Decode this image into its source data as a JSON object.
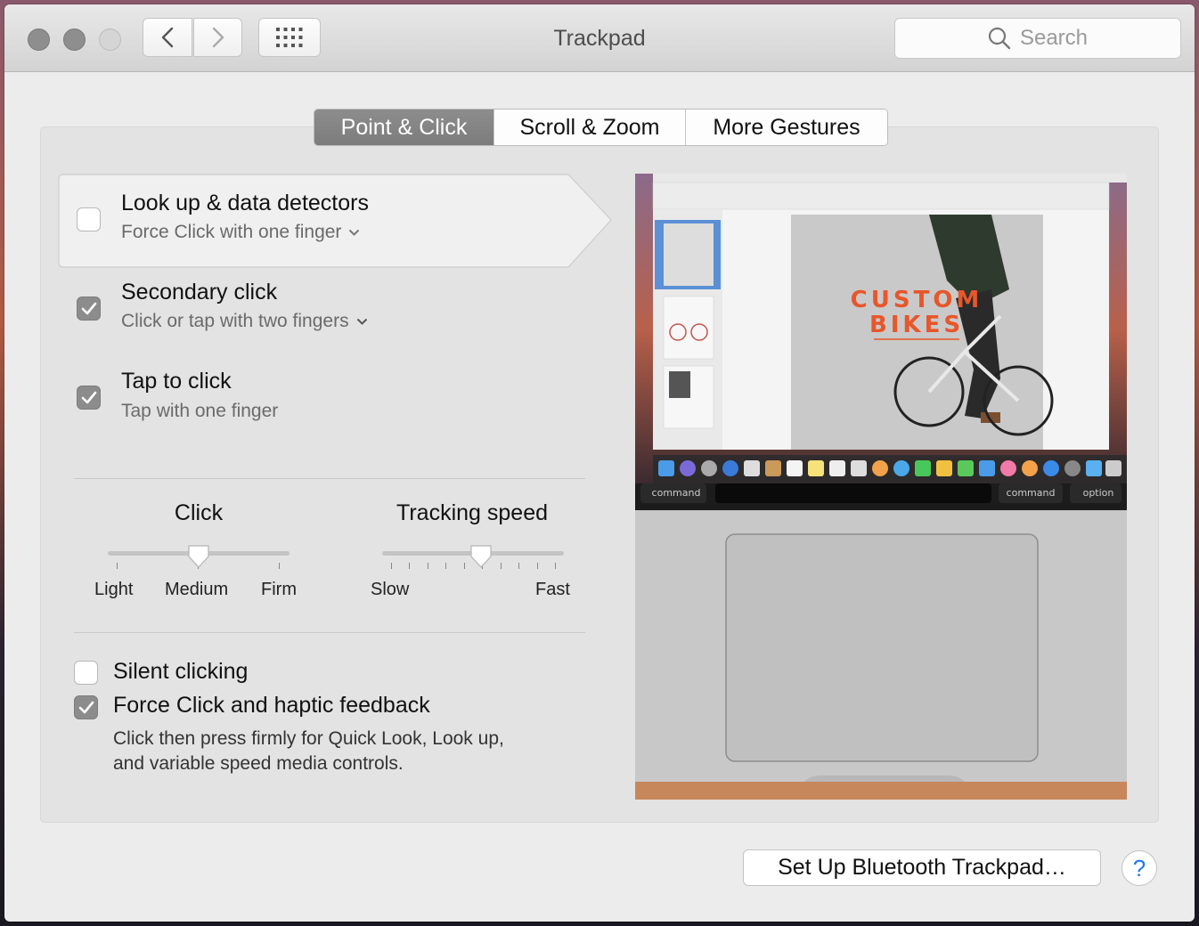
{
  "window": {
    "title": "Trackpad"
  },
  "toolbar": {
    "search_placeholder": "Search"
  },
  "tabs": [
    {
      "label": "Point & Click",
      "active": true
    },
    {
      "label": "Scroll & Zoom",
      "active": false
    },
    {
      "label": "More Gestures",
      "active": false
    }
  ],
  "options": {
    "lookup": {
      "title": "Look up & data detectors",
      "sub": "Force Click with one finger",
      "checked": false
    },
    "secondary": {
      "title": "Secondary click",
      "sub": "Click or tap with two fingers",
      "checked": true
    },
    "tap": {
      "title": "Tap to click",
      "sub": "Tap with one finger",
      "checked": true
    }
  },
  "sliders": {
    "click": {
      "label": "Click",
      "ticks": [
        "Light",
        "Medium",
        "Firm"
      ],
      "value": "Medium"
    },
    "tracking": {
      "label": "Tracking speed",
      "min_label": "Slow",
      "max_label": "Fast",
      "value_fraction": 0.55
    }
  },
  "bottom_options": {
    "silent": {
      "title": "Silent clicking",
      "checked": false
    },
    "force": {
      "title": "Force Click and haptic feedback",
      "checked": true,
      "desc_line1": "Click then press firmly for Quick Look, Look up,",
      "desc_line2": "and variable speed media controls."
    }
  },
  "preview": {
    "doc_title_line1": "CUSTOM",
    "doc_title_line2": "BIKES",
    "key_command_left": "command",
    "key_command_right": "command",
    "key_option": "option"
  },
  "buttons": {
    "bluetooth": "Set Up Bluetooth Trackpad…",
    "help": "?"
  },
  "colors": {
    "accent_orange": "#e8562a",
    "checkbox_on": "#8c8c8c",
    "tab_active": "#858585"
  }
}
